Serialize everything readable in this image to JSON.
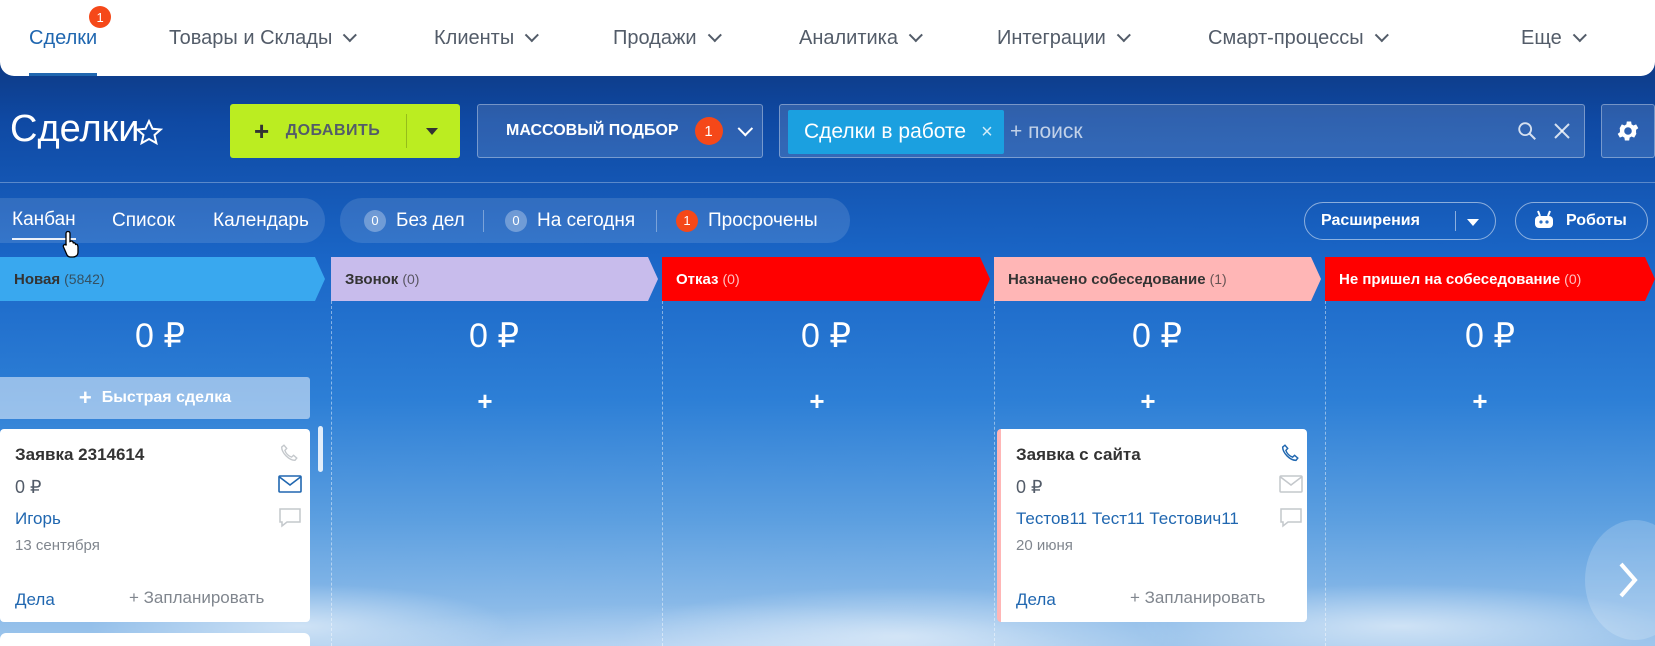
{
  "nav": {
    "items": [
      {
        "label": "Сделки",
        "badge": "1"
      },
      {
        "label": "Товары и Склады"
      },
      {
        "label": "Клиенты"
      },
      {
        "label": "Продажи"
      },
      {
        "label": "Аналитика"
      },
      {
        "label": "Интеграции"
      },
      {
        "label": "Смарт-процессы"
      },
      {
        "label": "Еще"
      }
    ]
  },
  "header": {
    "title": "Сделки",
    "add_label": "ДОБАВИТЬ",
    "mass_label": "МАССОВЫЙ ПОДБОР",
    "mass_badge": "1",
    "filter_chip": "Сделки в работе",
    "search_placeholder": "+ поиск"
  },
  "views": {
    "items": [
      "Канбан",
      "Список",
      "Календарь"
    ],
    "active": "Канбан"
  },
  "counters": [
    {
      "num": "0",
      "label": "Без дел"
    },
    {
      "num": "0",
      "label": "На сегодня"
    },
    {
      "num": "1",
      "label": "Просрочены"
    }
  ],
  "toolbar": {
    "extensions_label": "Расширения",
    "robots_label": "Роботы"
  },
  "kanban": {
    "quick_deal_label": "Быстрая сделка",
    "plus": "+",
    "columns": [
      {
        "name": "Новая",
        "count": "(5842)",
        "sum": "0 ₽",
        "color": "#39a8ef",
        "text_color": "#333333"
      },
      {
        "name": "Звонок",
        "count": "(0)",
        "sum": "0 ₽",
        "color": "#c8bcec",
        "text_color": "#333333"
      },
      {
        "name": "Отказ",
        "count": "(0)",
        "sum": "0 ₽",
        "color": "#ff0000",
        "text_color": "#ffffff"
      },
      {
        "name": "Назначено собеседование",
        "count": "(1)",
        "sum": "0 ₽",
        "color": "#ffb6b6",
        "text_color": "#333333"
      },
      {
        "name": "Не пришел на собеседование",
        "count": "(0)",
        "sum": "0 ₽",
        "color": "#ff0000",
        "text_color": "#ffffff"
      }
    ],
    "cards": [
      {
        "title": "Заявка 2314614",
        "price": "0 ₽",
        "contact": "Игорь",
        "date": "13 сентября",
        "deals": "Дела",
        "plan": "+ Запланировать"
      },
      {
        "title": "Заявка с сайта",
        "price": "0 ₽",
        "contact": "Тестов11 Тест11 Тестович11",
        "date": "20 июня",
        "deals": "Дела",
        "plan": "+ Запланировать"
      }
    ]
  },
  "colors": {
    "accent": "#2067b0",
    "add_button": "#bbed21",
    "badge": "#f54819",
    "filter_chip": "#1ba0e0"
  },
  "icons": [
    "star-icon",
    "search-icon",
    "close-icon",
    "gear-icon",
    "robot-icon",
    "phone-icon",
    "mail-icon",
    "chat-icon",
    "chevron-right-icon",
    "hand-cursor-icon"
  ]
}
